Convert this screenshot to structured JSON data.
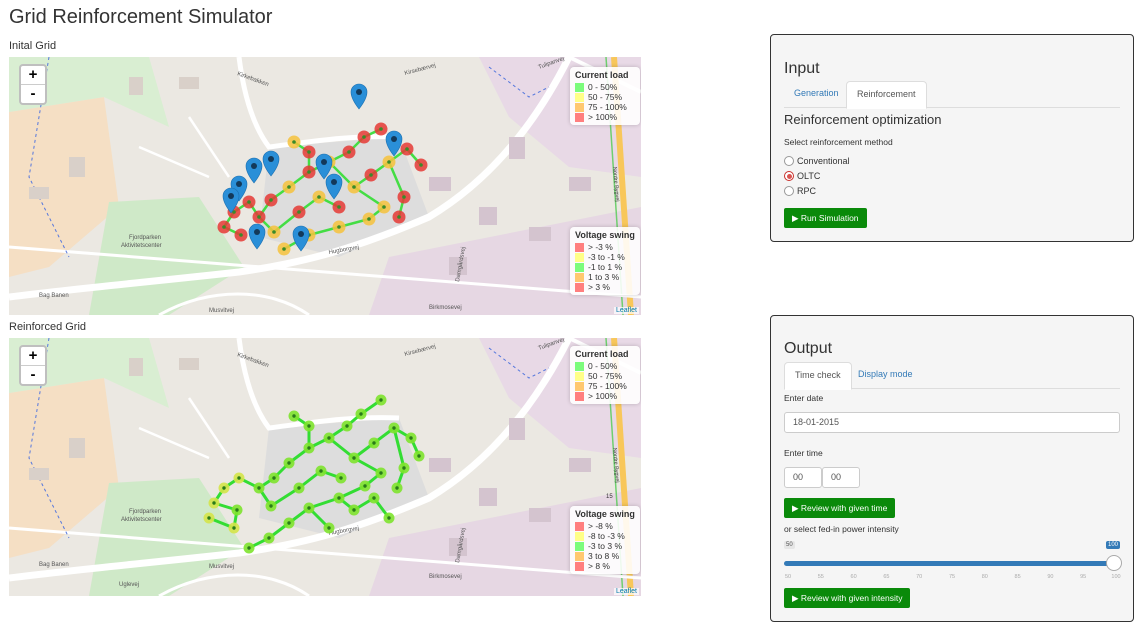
{
  "app_title": "Grid Reinforcement Simulator",
  "maps": {
    "initial_label": "Inital Grid",
    "reinforced_label": "Reinforced Grid",
    "zoom_in": "+",
    "zoom_out": "-",
    "attribution": "Leaflet",
    "street_labels": {
      "kirkebakken": "Kirkebakken",
      "kirsebaervej": "Kirsebærvej",
      "hugborgvej": "Hugborgvej",
      "birkmosevej": "Birkmosevej",
      "musvitvej": "Musvitvej",
      "nordre_bygvej": "Nordre Bygvej",
      "fjordparken": "Fjordparken",
      "aktivitetscenter": "Aktivitetscenter",
      "bag_banen": "Bag Banen",
      "damgaardsvej": "Damgårdsvej",
      "tulipanvej": "Tulipanvej",
      "uglevej": "Uglevej",
      "number_15": "15"
    },
    "current_load_legend": {
      "title": "Current load",
      "items": [
        {
          "label": "0 - 50%",
          "color": "#7cfc7c"
        },
        {
          "label": "50 - 75%",
          "color": "#ffff88"
        },
        {
          "label": "75 - 100%",
          "color": "#ffc870"
        },
        {
          "label": "> 100%",
          "color": "#ff7f7f"
        }
      ]
    },
    "voltage_legend_initial": {
      "title": "Voltage swing",
      "items": [
        {
          "label": "> -3 %",
          "color": "#ff7f7f"
        },
        {
          "label": "-3 to -1 %",
          "color": "#ffff88"
        },
        {
          "label": "-1 to 1 %",
          "color": "#7cfc7c"
        },
        {
          "label": "1 to 3 %",
          "color": "#ffc870"
        },
        {
          "label": "> 3 %",
          "color": "#ff7f7f"
        }
      ]
    },
    "voltage_legend_reinforced": {
      "title": "Voltage swing",
      "items": [
        {
          "label": "> -8 %",
          "color": "#ff7f7f"
        },
        {
          "label": "-8 to -3 %",
          "color": "#ffff88"
        },
        {
          "label": "-3 to 3 %",
          "color": "#7cfc7c"
        },
        {
          "label": "3 to 8 %",
          "color": "#ffc870"
        },
        {
          "label": "> 8 %",
          "color": "#ff7f7f"
        }
      ]
    }
  },
  "input_panel": {
    "title": "Input",
    "tabs": [
      "Generation",
      "Reinforcement"
    ],
    "active_tab": "Reinforcement",
    "section_title": "Reinforcement optimization",
    "method_label": "Select reinforcement method",
    "methods": [
      "Conventional",
      "OLTC",
      "RPC"
    ],
    "selected_method": "OLTC",
    "run_button": "▶ Run Simulation"
  },
  "output_panel": {
    "title": "Output",
    "tabs": [
      "Time check",
      "Display mode"
    ],
    "active_tab": "Time check",
    "date_label": "Enter date",
    "date_value": "18-01-2015",
    "time_label": "Enter time",
    "hour_value": "00",
    "minute_value": "00",
    "review_time_button": "▶ Review with given time",
    "intensity_label": "or select fed-in power intensity",
    "slider": {
      "min": 50,
      "max": 100,
      "value": 100,
      "ticks": [
        "50",
        "55",
        "60",
        "65",
        "70",
        "75",
        "80",
        "85",
        "90",
        "95",
        "100"
      ]
    },
    "review_intensity_button": "▶ Review with given intensity"
  }
}
